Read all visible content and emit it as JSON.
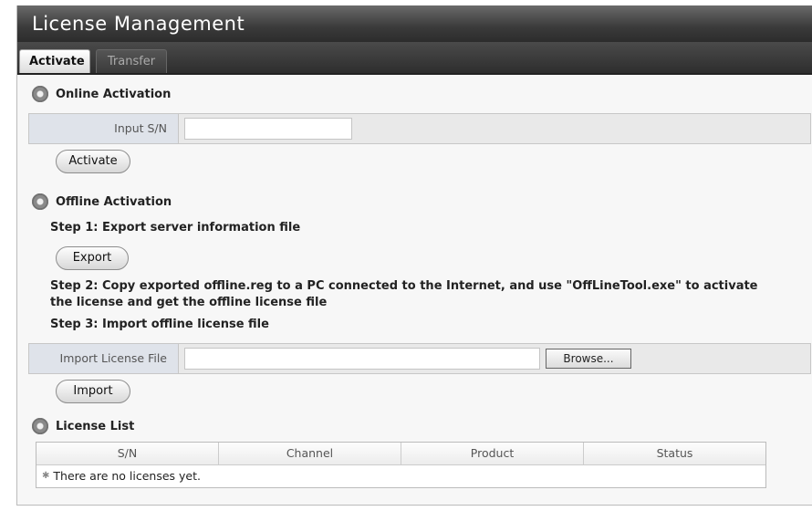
{
  "window": {
    "title": "License Management"
  },
  "tabs": [
    {
      "label": "Activate",
      "active": true
    },
    {
      "label": "Transfer",
      "active": false
    }
  ],
  "online": {
    "heading": "Online Activation",
    "sn_label": "Input S/N",
    "sn_value": "",
    "activate_label": "Activate"
  },
  "offline": {
    "heading": "Offline Activation",
    "step1": "Step 1: Export server information file",
    "export_label": "Export",
    "step2_line1": "Step 2: Copy exported offline.reg to a PC connected to the Internet, and use \"OffLineTool.exe\" to activate",
    "step2_line2": "the license and get the offline license file",
    "step3": "Step 3: Import offline license file",
    "import_file_label": "Import License File",
    "import_file_value": "",
    "browse_label": "Browse...",
    "import_label": "Import"
  },
  "license_list": {
    "heading": "License List",
    "columns": [
      "S/N",
      "Channel",
      "Product",
      "Status"
    ],
    "empty_message": "There are no licenses yet."
  }
}
